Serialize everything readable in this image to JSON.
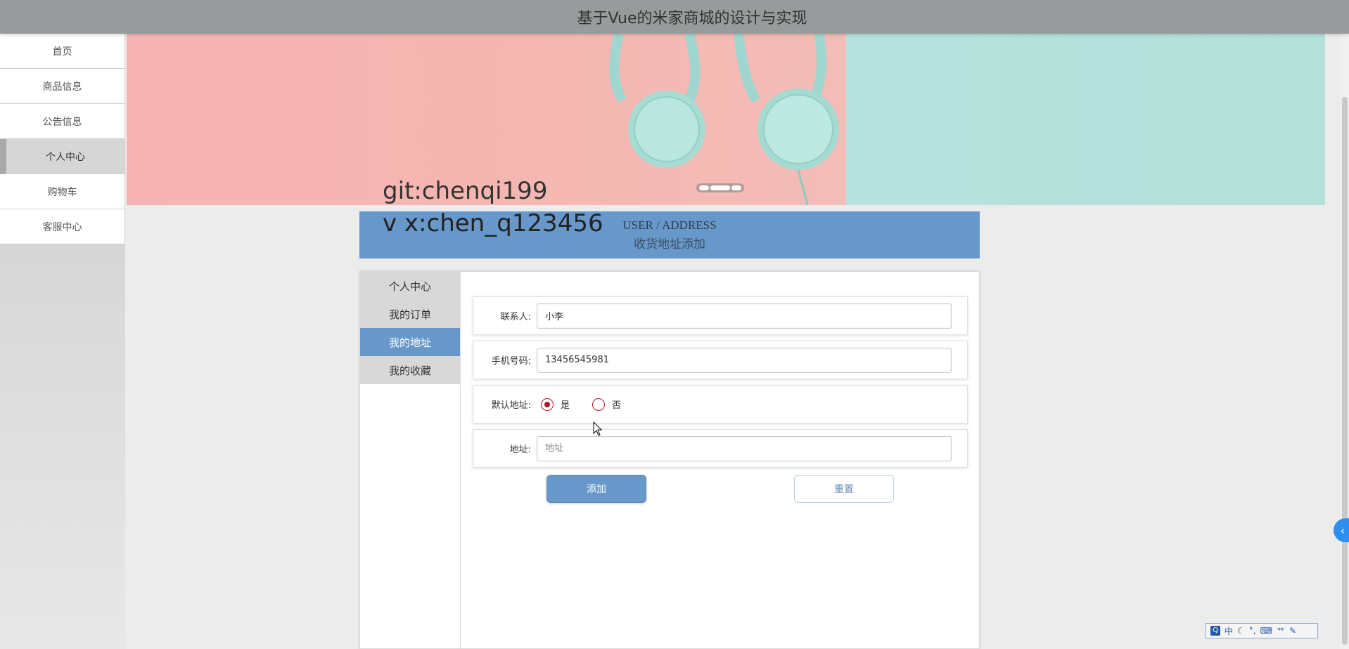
{
  "header": {
    "title": "基于Vue的米家商城的设计与实现"
  },
  "sidebar": {
    "items": [
      {
        "label": "首页"
      },
      {
        "label": "商品信息"
      },
      {
        "label": "公告信息"
      },
      {
        "label": "个人中心",
        "active": true
      },
      {
        "label": "购物车"
      },
      {
        "label": "客服中心"
      }
    ]
  },
  "banner": {
    "watermark_git": "git:chenqi199",
    "watermark_vx": "v x:chen_q123456"
  },
  "section": {
    "title_en": "USER / ADDRESS",
    "title_cn": "收货地址添加"
  },
  "user_menu": {
    "items": [
      {
        "label": "个人中心"
      },
      {
        "label": "我的订单"
      },
      {
        "label": "我的地址",
        "active": true
      },
      {
        "label": "我的收藏"
      }
    ]
  },
  "form": {
    "contact": {
      "label": "联系人:",
      "value": "小李"
    },
    "phone": {
      "label": "手机号码:",
      "value": "13456545981"
    },
    "default_address": {
      "label": "默认地址:",
      "options": [
        "是",
        "否"
      ],
      "selected": "是"
    },
    "address": {
      "label": "地址:",
      "placeholder": "地址",
      "value": ""
    },
    "add_button": "添加",
    "reset_button": "重置"
  },
  "ime_toolbar": {
    "logo": "Q",
    "mode": "中"
  },
  "colors": {
    "accent": "#6898c9",
    "header": "#979b9b",
    "radio": "#b0182e"
  }
}
